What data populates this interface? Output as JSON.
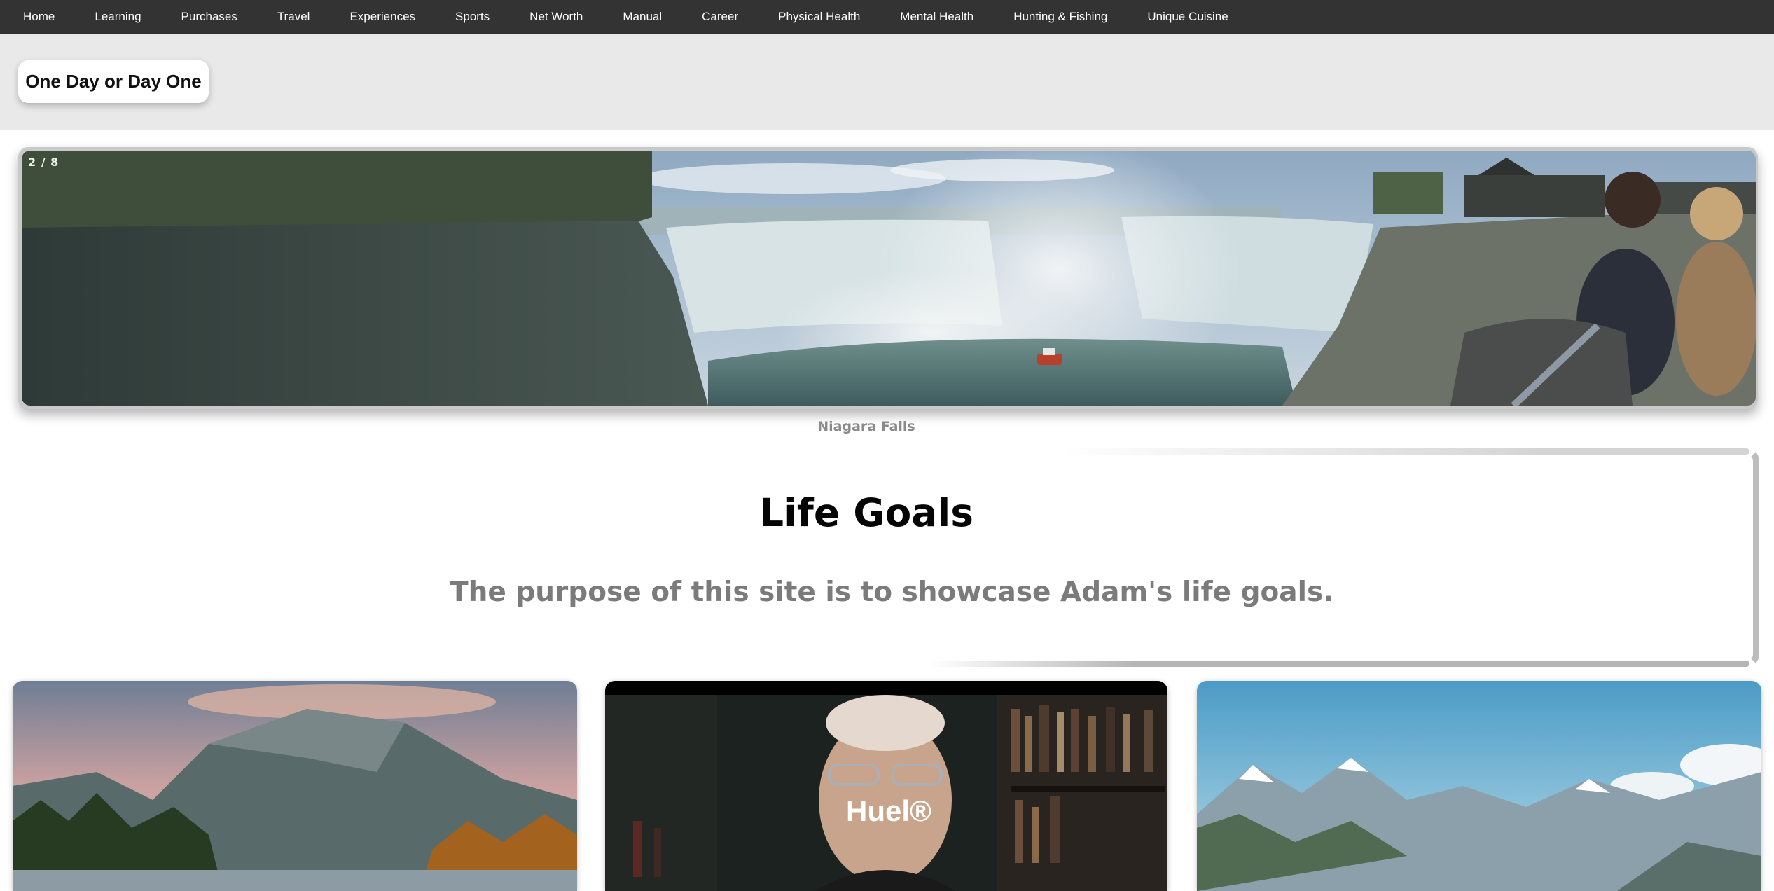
{
  "nav": {
    "items": [
      {
        "label": "Home"
      },
      {
        "label": "Learning"
      },
      {
        "label": "Purchases"
      },
      {
        "label": "Travel"
      },
      {
        "label": "Experiences"
      },
      {
        "label": "Sports"
      },
      {
        "label": "Net Worth"
      },
      {
        "label": "Manual"
      },
      {
        "label": "Career"
      },
      {
        "label": "Physical Health"
      },
      {
        "label": "Mental Health"
      },
      {
        "label": "Hunting & Fishing"
      },
      {
        "label": "Unique Cuisine"
      }
    ]
  },
  "header": {
    "brand": "One Day or Day One"
  },
  "slideshow": {
    "counter": "2 / 8",
    "caption": "Niagara Falls",
    "image": "niagara-falls-photo"
  },
  "goals": {
    "title": "Life Goals",
    "subtitle": "The purpose of this site is to showcase Adam's life goals."
  },
  "cards": [
    {
      "image": "mountain-lake-photo"
    },
    {
      "image": "huel-video-thumbnail",
      "logo_text": "Huel®"
    },
    {
      "image": "snowy-mountains-photo"
    }
  ],
  "colors": {
    "nav_bg": "#333333",
    "header_bg": "#e9e9e9",
    "caption_gray": "#8a8a8a",
    "subtitle_gray": "#7b7b7b"
  }
}
